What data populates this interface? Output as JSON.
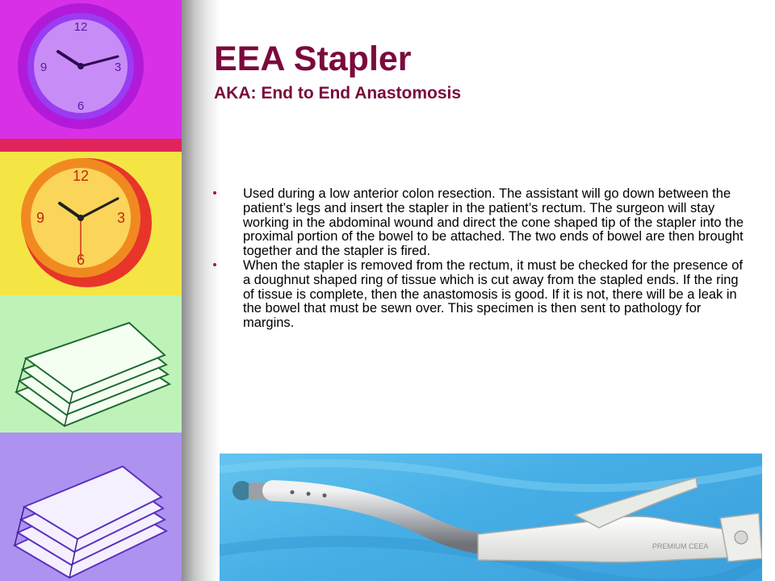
{
  "slide": {
    "title": "EEA Stapler",
    "subtitle": "AKA: End to End Anastomosis",
    "bullets": [
      "Used during a low anterior colon resection.  The assistant will go down between the patient’s legs and insert the stapler in the patient’s rectum.  The surgeon will stay working in the abdominal wound and direct the cone shaped tip of the stapler into the proximal portion of the bowel to be attached.  The two ends of bowel are then brought together and the stapler is fired.",
      "When the stapler is removed from the rectum, it must be checked for the presence of a doughnut shaped ring of tissue which is cut away from the stapled ends.  If the ring of tissue is complete, then the anastomosis is good.  If it is not, there will be a leak in the bowel that must be sewn over.  This specimen is then sent to pathology for margins."
    ]
  },
  "colors": {
    "title": "#7a0a3c",
    "bullet_marker": "#b01040",
    "body_text": "#000000",
    "tile_magenta": "#e03ce8",
    "tile_yellow": "#f2e642",
    "tile_green": "#b9f0b4",
    "tile_violet": "#a98ef0",
    "photo_background": "#46aee6"
  },
  "decor": {
    "tile_1_icon": "wall-clock-icon",
    "tile_2_icon": "wall-clock-icon",
    "tile_3_icon": "paper-stack-icon",
    "tile_4_icon": "paper-stack-icon",
    "photo_subject": "eea-stapler-device"
  }
}
